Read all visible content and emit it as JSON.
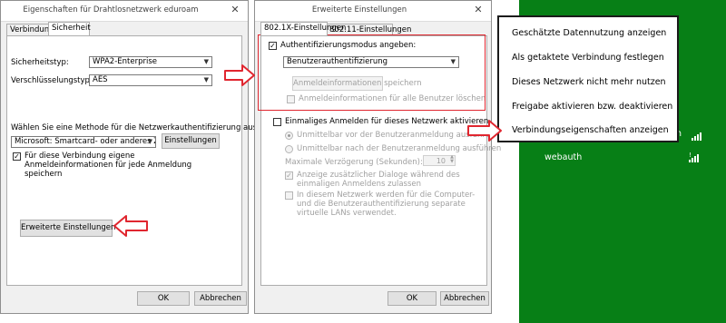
{
  "dialog_left": {
    "title": "Eigenschaften für Drahtlosnetzwerk eduroam",
    "close_glyph": "✕",
    "tabs": [
      "Verbindung",
      "Sicherheit"
    ],
    "security_type_label": "Sicherheitstyp:",
    "security_type_value": "WPA2-Enterprise",
    "encryption_type_label": "Verschlüsselungstyp:",
    "encryption_type_value": "AES",
    "auth_method_label": "Wählen Sie eine Methode für die Netzwerkauthentifizierung aus:",
    "auth_method_value": "Microsoft: Smartcard- oder anderes Zertif",
    "settings_button": "Einstellungen",
    "remember_credentials_label": "Für diese Verbindung eigene Anmeldeinformationen für jede Anmeldung speichern",
    "advanced_button": "Erweiterte Einstellungen",
    "ok_button": "OK",
    "cancel_button": "Abbrechen"
  },
  "dialog_right": {
    "title": "Erweiterte Einstellungen",
    "close_glyph": "✕",
    "tabs": [
      "802.1X-Einstellungen",
      "802.11-Einstellungen"
    ],
    "auth_mode_label": "Authentifizierungsmodus angeben:",
    "auth_mode_value": "Benutzerauthentifizierung",
    "save_credentials_button": "Anmeldeinformationen speichern",
    "delete_credentials_label": "Anmeldeinformationen für alle Benutzer löschen",
    "sso_label": "Einmaliges Anmelden für dieses Netzwerk aktivieren",
    "sso_before_label": "Unmittelbar vor der Benutzeranmeldung ausführen",
    "sso_after_label": "Unmittelbar nach der Benutzeranmeldung ausführen",
    "max_delay_label": "Maximale Verzögerung (Sekunden):",
    "max_delay_value": "10",
    "show_dialogs_label": "Anzeige zusätzlicher Dialoge während des einmaligen Anmeldens zulassen",
    "separate_vlans_label": "In diesem Netzwerk werden für die Computer- und die Benutzerauthentifizierung separate virtuelle LANs verwendet.",
    "ok_button": "OK",
    "cancel_button": "Abbrechen"
  },
  "context_menu": {
    "items": [
      "Geschätzte Datennutzung anzeigen",
      "Als getaktete Verbindung festlegen",
      "Dieses Netzwerk nicht mehr nutzen",
      "Freigabe aktivieren bzw. deaktivieren",
      "Verbindungseigenschaften anzeigen"
    ]
  },
  "network_panel": {
    "partial_network_char": "n",
    "network_webauth": "webauth"
  },
  "colors": {
    "highlight_red": "#e0262f",
    "network_panel_green": "#077f16"
  }
}
